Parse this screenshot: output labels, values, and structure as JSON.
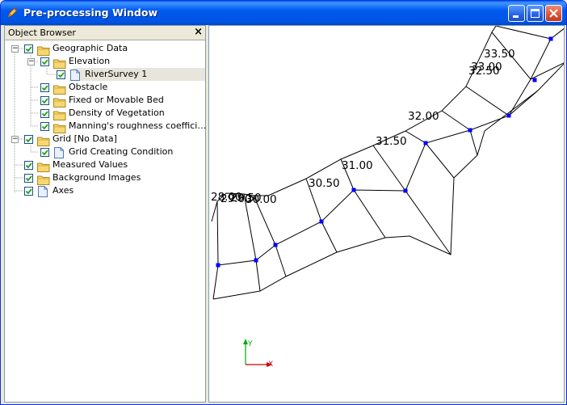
{
  "window": {
    "title": "Pre-processing Window",
    "controls": [
      "minimize-icon",
      "maximize-icon",
      "close-icon"
    ]
  },
  "object_browser": {
    "title": "Object Browser",
    "close_glyph": "×",
    "items": [
      {
        "label": "Geographic Data",
        "icon": "folder-icon",
        "checked": true,
        "expanded": true,
        "level": 0
      },
      {
        "label": "Elevation",
        "icon": "folder-icon",
        "checked": true,
        "expanded": true,
        "level": 1
      },
      {
        "label": "RiverSurvey 1",
        "icon": "document-icon",
        "checked": true,
        "level": 2,
        "selected": true
      },
      {
        "label": "Obstacle",
        "icon": "folder-icon",
        "checked": true,
        "level": 1
      },
      {
        "label": "Fixed or Movable Bed",
        "icon": "folder-icon",
        "checked": true,
        "level": 1
      },
      {
        "label": "Density of Vegetation",
        "icon": "folder-icon",
        "checked": true,
        "level": 1
      },
      {
        "label": "Manning's roughness coeffici…",
        "icon": "folder-icon",
        "checked": true,
        "level": 1
      },
      {
        "label": "Grid [No Data]",
        "icon": "folder-icon",
        "checked": true,
        "expanded": true,
        "level": 0
      },
      {
        "label": "Grid Creating Condition",
        "icon": "document-icon",
        "checked": true,
        "level": 1
      },
      {
        "label": "Measured Values",
        "icon": "folder-icon",
        "checked": true,
        "level": 0
      },
      {
        "label": "Background Images",
        "icon": "folder-icon",
        "checked": true,
        "level": 0
      },
      {
        "label": "Axes",
        "icon": "document-icon",
        "checked": true,
        "level": 0
      }
    ]
  },
  "viewer": {
    "cross_section_labels": [
      "33.50",
      "33.00",
      "32.50",
      "32.00",
      "31.50",
      "31.00",
      "30.50",
      "28.00",
      "29.00",
      "29.50",
      "30.00"
    ],
    "axes": {
      "x_label": "X",
      "y_label": "Y",
      "x_color": "#cc0000",
      "y_color": "#00aa00"
    },
    "node_color": "#0000ff"
  }
}
